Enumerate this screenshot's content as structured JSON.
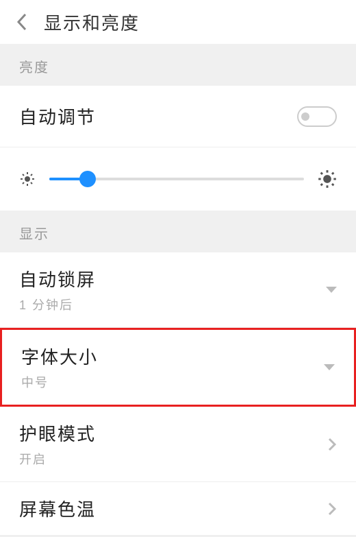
{
  "header": {
    "title": "显示和亮度"
  },
  "sections": {
    "brightness": {
      "label": "亮度",
      "auto_adjust": "自动调节",
      "toggle_state": "off",
      "slider_percent": 15
    },
    "display": {
      "label": "显示",
      "auto_lock": {
        "title": "自动锁屏",
        "value": "1 分钟后"
      },
      "font_size": {
        "title": "字体大小",
        "value": "中号"
      },
      "eye_mode": {
        "title": "护眼模式",
        "value": "开启"
      },
      "color_temp": {
        "title": "屏幕色温"
      }
    }
  }
}
